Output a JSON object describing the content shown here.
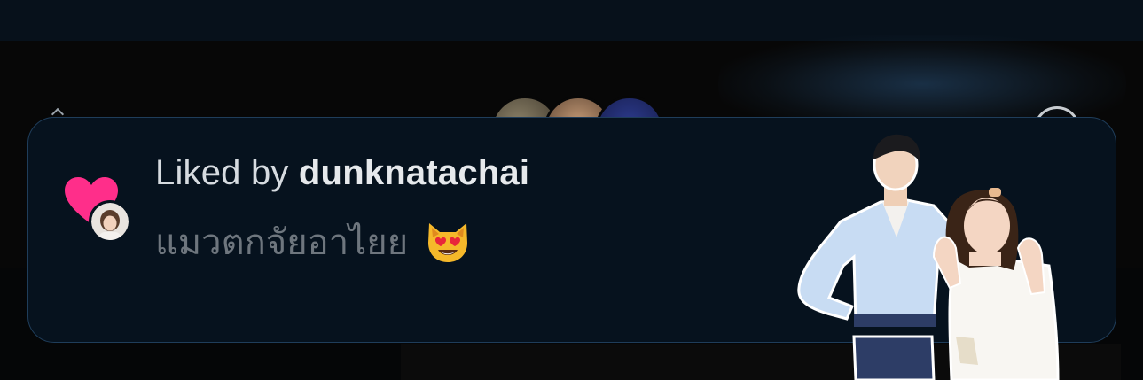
{
  "notification": {
    "prefix": "Liked by",
    "username": "dunknatachai",
    "message": "แมวตกจัยอาไยย",
    "emoji": "smiling-cat-heart-eyes-emoji",
    "heart_icon": "heart-icon",
    "heart_color": "#ff2e8a"
  },
  "colors": {
    "card_background": "#06121e",
    "card_border": "#1f3d5a",
    "title_text": "#d6dbe0",
    "message_text": "#6e767e"
  }
}
